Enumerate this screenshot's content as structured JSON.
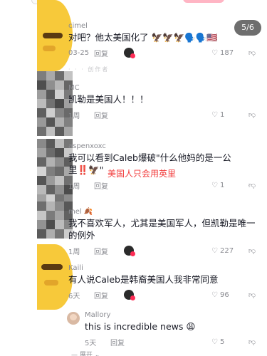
{
  "page_indicator": "5/6",
  "comments": [
    {
      "username": "cimel",
      "text": "对吧？他太美国化了 🦅🦅🦅🗣️🗣️🇺🇸",
      "time": "03-25",
      "reply": "回复",
      "likes": "187"
    },
    {
      "username": "MC",
      "text": "凯勒是美国人！！！",
      "time": "1周",
      "reply": "回复",
      "likes": "1"
    },
    {
      "username": "aspenxoxc",
      "text": "我可以看到Caleb爆破\"什么他妈的是一公里‼️🦅\"",
      "time": "1周",
      "reply": "回复",
      "likes": "1"
    },
    {
      "username": "mel 🍂",
      "text": "我不喜欢军人，尤其是美国军人，但凯勒是唯一的例外",
      "time": "1周",
      "reply": "回复",
      "likes": "227"
    },
    {
      "username": "Kaili",
      "text": "有人说Caleb是韩裔美国人我非常同意",
      "time": "6天",
      "reply": "回复",
      "likes": "96"
    },
    {
      "username": "Mallory",
      "text": "this is incredible news 😩",
      "time": "5天",
      "reply": "回复",
      "likes": "5"
    }
  ],
  "overlay_note": "美国人只会用英里",
  "faded_row_text": "· · · 创作者",
  "bottom_label": "— 展开 ⌄"
}
